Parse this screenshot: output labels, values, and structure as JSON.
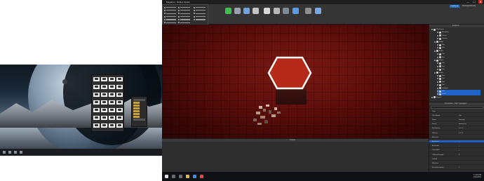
{
  "window": {
    "title": "Magebox - Roblox Studio",
    "controls": {
      "minimize": "—",
      "maximize": "☐",
      "close": "✕"
    },
    "user": "PresidentOmnify"
  },
  "ribbon": {
    "active_tab": "Collaborate",
    "buttons": [
      {
        "name": "terrain-button",
        "color": "#3fbf4f"
      },
      {
        "name": "part-button",
        "color": "#9aa3ad"
      },
      {
        "name": "ui-button",
        "color": "#6fa2de"
      },
      {
        "name": "material-button",
        "color": "#c4c4c4"
      },
      {
        "name": "move-button",
        "color": "#d9d9d9"
      },
      {
        "name": "group-button",
        "color": "#b8b8b8"
      },
      {
        "name": "anchor-button",
        "color": "#7f8894"
      },
      {
        "name": "play-button",
        "color": "#5a9ae6"
      },
      {
        "name": "settings-button",
        "color": "#8f8f8f"
      },
      {
        "name": "team-create-button",
        "color": "#7aa9e0"
      }
    ]
  },
  "panels": {
    "output_title": "Output",
    "explorer_title": "Explorer",
    "properties_title": "Properties - Part \"Hexagon\""
  },
  "explorer_items": [
    {
      "label": "Workspace",
      "selected": false
    },
    {
      "label": "Baseplate",
      "selected": false
    },
    {
      "label": "Terrain",
      "selected": false
    },
    {
      "label": "Camera",
      "selected": false
    },
    {
      "label": "Model",
      "selected": false
    },
    {
      "label": "Part",
      "selected": false
    },
    {
      "label": "Part",
      "selected": false
    },
    {
      "label": "Model",
      "selected": false
    },
    {
      "label": "Part",
      "selected": false
    },
    {
      "label": "Part",
      "selected": false
    },
    {
      "label": "Model",
      "selected": false
    },
    {
      "label": "Part",
      "selected": false
    },
    {
      "label": "Part",
      "selected": false
    },
    {
      "label": "Part",
      "selected": false
    },
    {
      "label": "Model",
      "selected": false
    },
    {
      "label": "Part",
      "selected": false
    },
    {
      "label": "Part",
      "selected": false
    },
    {
      "label": "Part",
      "selected": false
    },
    {
      "label": "Part",
      "selected": false
    },
    {
      "label": "Hexagon",
      "selected": false
    },
    {
      "label": "Part",
      "selected": true
    },
    {
      "label": "Union",
      "selected": true
    },
    {
      "label": "Players",
      "selected": false
    }
  ],
  "properties": [
    {
      "key": "Data",
      "value": ""
    },
    {
      "key": "ClassName",
      "value": "Part"
    },
    {
      "key": "Name",
      "value": "Hexagon"
    },
    {
      "key": "Parent",
      "value": "Workspace"
    },
    {
      "key": "RotVelocity",
      "value": "0, 0, 0"
    },
    {
      "key": "Velocity",
      "value": "0, 0, 0"
    },
    {
      "key": "Behavior",
      "value": ""
    },
    {
      "key": "Anchored",
      "value": "✓",
      "selected": true
    },
    {
      "key": "Archivable",
      "value": "✓"
    },
    {
      "key": "CanCollide",
      "value": "✓"
    },
    {
      "key": "CollisionGroupId",
      "value": "0"
    },
    {
      "key": "Locked",
      "value": ""
    },
    {
      "key": "Massless",
      "value": ""
    },
    {
      "key": "ResizeIncrement",
      "value": "1"
    }
  ],
  "colors": {
    "accent": "#1f63c7",
    "hexagon_fill": "#b52a18",
    "hexagon_outline": "#ffffff",
    "viewport_bg": "#5a0e0b"
  },
  "clock": {
    "time": "11:42 PM",
    "date": "1/14/2019"
  }
}
